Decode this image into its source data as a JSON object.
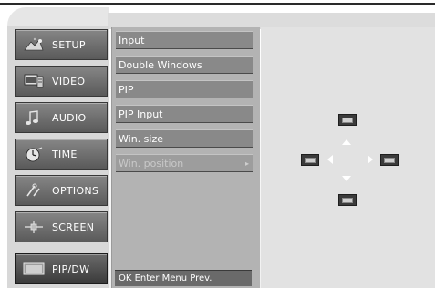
{
  "left_menu": {
    "items": [
      {
        "label": "SETUP",
        "icon": "setup-icon",
        "active": false
      },
      {
        "label": "VIDEO",
        "icon": "video-icon",
        "active": false
      },
      {
        "label": "AUDIO",
        "icon": "audio-icon",
        "active": false
      },
      {
        "label": "TIME",
        "icon": "time-icon",
        "active": false
      },
      {
        "label": "OPTIONS",
        "icon": "options-icon",
        "active": false
      },
      {
        "label": "SCREEN",
        "icon": "screen-icon",
        "active": false
      },
      {
        "label": "PIP/DW",
        "icon": "pip-dw-icon",
        "active": true
      }
    ]
  },
  "sub_menu": {
    "items": [
      {
        "label": "Input"
      },
      {
        "label": "Double Windows"
      },
      {
        "label": "PIP"
      },
      {
        "label": "PIP Input"
      },
      {
        "label": "Win. size"
      },
      {
        "label": "Win. position",
        "selected": true
      }
    ],
    "submenu_arrow": "▸"
  },
  "help": {
    "text": "OK Enter Menu Prev."
  },
  "preview": {
    "position_windows": [
      "top",
      "left",
      "right",
      "bottom"
    ]
  },
  "colors": {
    "menu_button": "#6e6e6e",
    "submenu_item": "#898989",
    "preview_bg": "#e2e2e2"
  }
}
